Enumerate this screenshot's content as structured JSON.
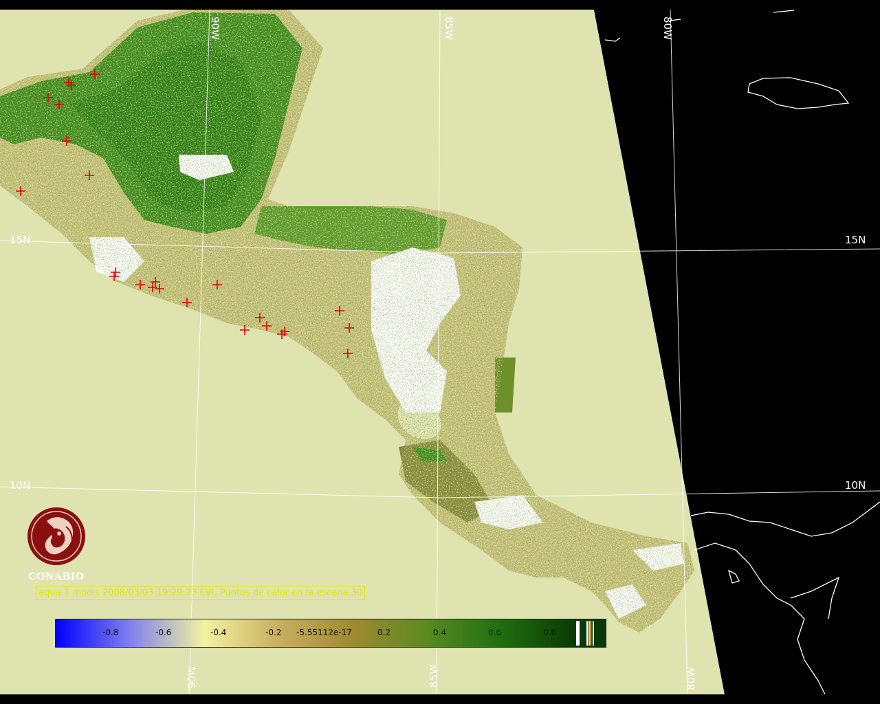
{
  "map": {
    "grid_labels": {
      "top": [
        "90W",
        "85W",
        "80W"
      ],
      "bottom": [
        "90W",
        "85W",
        "80W"
      ],
      "left": [
        "15N",
        "10N"
      ],
      "right": [
        "15N",
        "10N"
      ]
    },
    "fire_markers_count": 24,
    "colors": {
      "scene_background": "#dfe3b0",
      "space": "#000000",
      "vegetation_dense": "#2e7d10",
      "vegetation_medium": "#8fa83a",
      "sparse": "#c8bf78",
      "cloud": "#ffffff",
      "fire_marker": "#e00000",
      "grid": "#ffffff"
    }
  },
  "logo": {
    "text": "CONABIO",
    "icon": "conabio-macaw-icon"
  },
  "caption": {
    "text": "aqua-1 modis 2008/03/03 19:29:23 EVI. Puntos de calor en la escena 30"
  },
  "colorbar": {
    "ticks": [
      "-0.8",
      "-0.6",
      "-0.4",
      "-0.2",
      "-5.55112e-17",
      "0.2",
      "0.4",
      "0.6",
      "0.8"
    ],
    "stops": [
      "#0000ff",
      "#8080ee",
      "#f2f2a0",
      "#c8b060",
      "#a08a30",
      "#5a8a20",
      "#1f6f10",
      "#0a3a05"
    ]
  }
}
